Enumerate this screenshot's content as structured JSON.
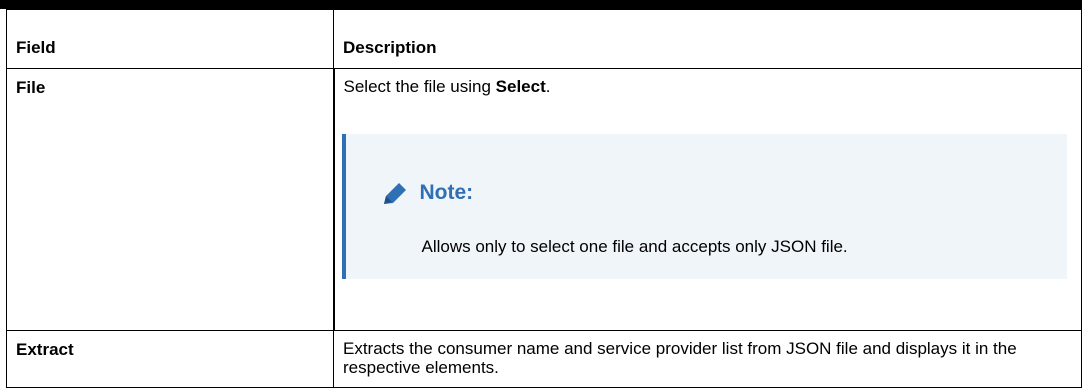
{
  "table": {
    "headers": {
      "field": "Field",
      "description": "Description"
    },
    "rows": [
      {
        "field": "File",
        "description_prefix": "Select the file using ",
        "description_bold": "Select",
        "description_suffix": ".",
        "note": {
          "icon": "pencil-icon",
          "title": "Note:",
          "text": "Allows only to select one file and accepts only JSON file."
        }
      },
      {
        "field": "Extract",
        "description": "Extracts the consumer name and service provider list from JSON file and displays it in the respective elements."
      }
    ]
  },
  "colors": {
    "note_accent": "#2f6fb3",
    "note_background": "#f0f5fa"
  }
}
